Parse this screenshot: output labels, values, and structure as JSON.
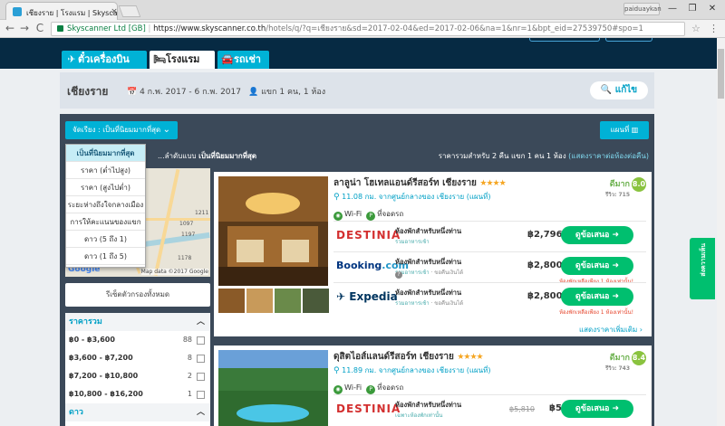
{
  "browser": {
    "tab_title": "เชียงราย | โรงแรม | Skyscanner",
    "tab_close": "×",
    "profile": "paiduaykan",
    "minimize": "—",
    "maximize": "❐",
    "close": "✕",
    "back": "←",
    "forward": "→",
    "reload": "C",
    "site_name": "Skyscanner Ltd [GB]",
    "url_host": "https://www.skyscanner.co.th",
    "url_path": "/hotels/q/?q=เชียงราย&sd=2017-02-04&ed=2017-02-06&na=1&nr=1&bpt_eid=27539750#spo=1",
    "star": "☆",
    "menu": "⋮"
  },
  "product_tabs": [
    {
      "label": "ตั๋วเครื่องบิน",
      "icon": "plane-icon",
      "glyph": "✈"
    },
    {
      "label": "โรงแรม",
      "icon": "bed-icon",
      "glyph": "🛏"
    },
    {
      "label": "รถเช่า",
      "icon": "car-icon",
      "glyph": "🚘"
    }
  ],
  "search": {
    "city": "เชียงราย",
    "dates": "4 ก.พ. 2017 - 6 ก.พ. 2017",
    "guests": "แขก 1 คน, 1 ห้อง",
    "edit_label": "แก้ไข"
  },
  "toolbar": {
    "sort_label": "จัดเรียง : เป็นที่นิยมมากที่สุด",
    "map_label": "แผนที่",
    "sort_prefix": "...ลำดับแบบ",
    "sort_value": "เป็นที่นิยมมากที่สุด",
    "price_info": "ราคารวมสำหรับ 2 คืน แขก 1 คน 1 ห้อง",
    "price_info_link": "(แสดงราคาต่อห้องต่อคืน)"
  },
  "sort_options": [
    "เป็นที่นิยมมากที่สุด",
    "ราคา (ต่ำไปสูง)",
    "ราคา (สูงไปต่ำ)",
    "ระยะห่างถึงใจกลางเมือง",
    "การให้คะแนนของแขก",
    "ดาว (5 ถึง 1)",
    "ดาว (1 ถึง 5)"
  ],
  "map": {
    "labels": [
      "1097",
      "1197",
      "1211",
      "1178"
    ],
    "google": "Google",
    "credit": "Map data ©2017 Google"
  },
  "sidebar": {
    "reset": "รีเซ็ตตัวกรองทั้งหมด",
    "price_heading": "ราคารวม",
    "price_rows": [
      {
        "range": "฿0 - ฿3,600",
        "count": "88"
      },
      {
        "range": "฿3,600 - ฿7,200",
        "count": "8"
      },
      {
        "range": "฿7,200 - ฿10,800",
        "count": "2"
      },
      {
        "range": "฿10,800 - ฿16,200",
        "count": "1"
      }
    ],
    "stars_heading": "ดาว"
  },
  "hotels": [
    {
      "name": "ลาลูน่า โฮเทลแอนด์รีสอร์ท เชียงราย",
      "stars": "★★★★",
      "distance": "11.08 กม. จากศูนย์กลางของ เชียงราย (แผนที่)",
      "rating_word": "ดีมาก",
      "reviews": "รีวิว: 715",
      "score": "8.0",
      "amenity_wifi": "Wi-Fi",
      "amenity_parking": "ที่จอดรถ",
      "deals": [
        {
          "provider": "DESTINIA",
          "room": "ห้องพักสำหรับหนึ่งท่าน",
          "sub": "รวมอาหารเช้า",
          "sub2": "",
          "price": "฿2,796",
          "cta": "ดูข้อเสนอ ➜",
          "note": ""
        },
        {
          "provider": "Booking",
          "provider_suffix": ".com",
          "room": "ห้องพักสำหรับหนึ่งท่าน",
          "sub": "รวมอาหารเช้า",
          "sub2": "· ขอคืนเงินได้",
          "price": "฿2,800",
          "cta": "ดูข้อเสนอ ➜",
          "note": "ห้องพักเหลือเพียง 1 ห้องเท่านั้น!"
        },
        {
          "provider": "Expedia",
          "room": "ห้องพักสำหรับหนึ่งท่าน",
          "sub": "รวมอาหารเช้า",
          "sub2": "· ขอคืนเงินได้",
          "price": "฿2,800",
          "cta": "ดูข้อเสนอ ➜",
          "note": "ห้องพักเหลือเพียง 1 ห้องเท่านั้น!"
        }
      ],
      "more": "แสดงราคาเพิ่มเติม ›"
    },
    {
      "name": "ดุสิตไอส์แลนด์รีสอร์ท เชียงราย",
      "stars": "★★★★",
      "distance": "11.89 กม. จากศูนย์กลางของ เชียงราย (แผนที่)",
      "rating_word": "ดีมาก",
      "reviews": "รีวิว: 743",
      "score": "8.4",
      "amenity_wifi": "Wi-Fi",
      "amenity_parking": "ที่จอดรถ",
      "deals": [
        {
          "provider": "DESTINIA",
          "room": "ห้องพักสำหรับหนึ่งท่าน",
          "sub": "เฉพาะห้องพักเท่านั้น",
          "old_price": "฿5,810",
          "price": "฿5,421",
          "cta": "ดูข้อเสนอ ➜"
        }
      ]
    }
  ],
  "feedback": "ส่งความเห็น",
  "colors": {
    "brand": "#00b2d6",
    "cta": "#00bf6f",
    "dark": "#3b4959",
    "navy": "#062a43"
  }
}
